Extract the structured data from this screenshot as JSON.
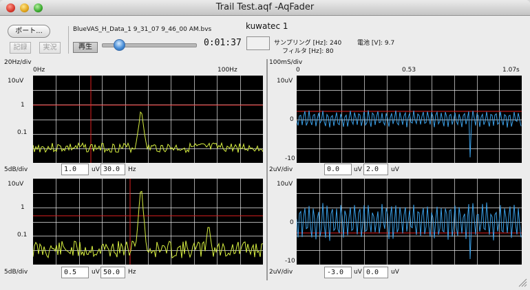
{
  "window": {
    "title": "Trail Test.aqf -AqFader"
  },
  "toolbar": {
    "port_label": "ポート...",
    "record_label": "記録",
    "live_label": "実況",
    "play_label": "再生",
    "file_name": "BlueVAS_H_Data_1 9_31_07 9_46_00 AM.bvs",
    "elapsed": "0:01:37",
    "device_name": "kuwatec 1",
    "sampling_label": "サンプリング [Hz]: 240",
    "filter_label": "フィルタ [Hz]: 80",
    "battery_label": "電池 [V]: 9.7",
    "playback_position": 0.18
  },
  "freq_panel": {
    "scale_label": "20Hz/div",
    "x_start": "0Hz",
    "x_end": "100Hz",
    "top": {
      "y_top": "10uV",
      "y_mid": "1",
      "y_low": "0.1",
      "db_label": "5dB/div",
      "value_a": "1.0",
      "unit_a": "uV",
      "value_b": "30.0",
      "unit_b": "Hz"
    },
    "bottom": {
      "y_top": "10uV",
      "y_mid": "1",
      "y_low": "0.1",
      "db_label": "5dB/div",
      "value_a": "0.5",
      "unit_a": "uV",
      "value_b": "50.0",
      "unit_b": "Hz"
    }
  },
  "time_panel": {
    "scale_label": "100mS/div",
    "x_start": "0",
    "x_mid": "0.53",
    "x_end": "1.07s",
    "top": {
      "y_top": "10uV",
      "y_mid": "0",
      "y_low": "-10",
      "div_label": "2uV/div",
      "value_a": "0.0",
      "unit_a": "uV",
      "value_b": "2.0",
      "unit_b": "uV"
    },
    "bottom": {
      "y_top": "10uV",
      "y_mid": "0",
      "y_low": "-10",
      "div_label": "2uV/div",
      "value_a": "-3.0",
      "unit_a": "uV",
      "value_b": "0.0",
      "unit_b": "uV"
    }
  },
  "colors": {
    "trace_spectrum": "#d8f040",
    "trace_wave": "#3aa0e8",
    "cursor": "#e02020",
    "grid": "#e8e8e8",
    "plot_bg": "#000000"
  },
  "icons": {
    "resize": "resize-grip-icon"
  }
}
